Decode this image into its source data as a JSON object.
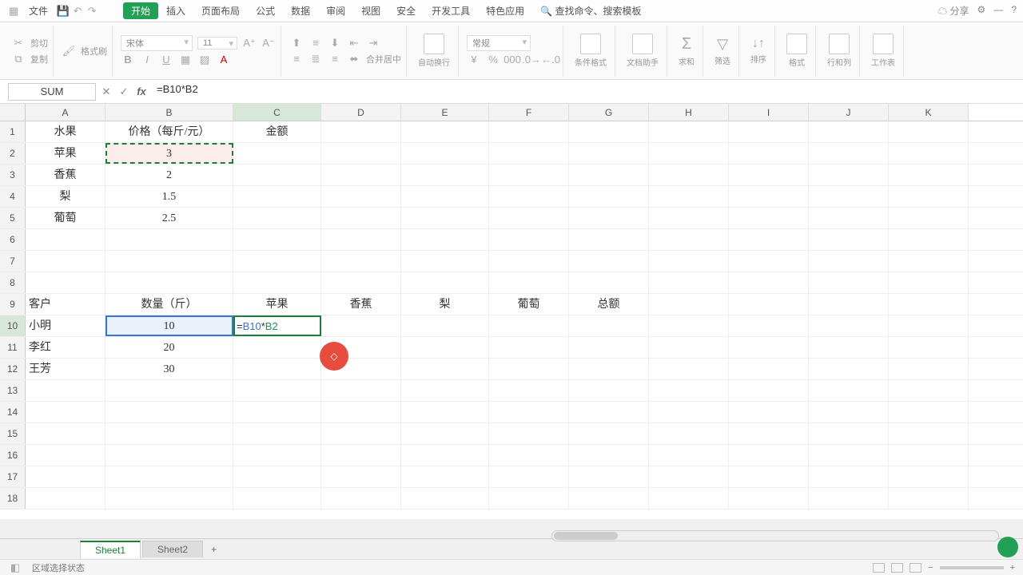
{
  "menu": {
    "file": "文件",
    "items": [
      "插入",
      "页面布局",
      "公式",
      "数据",
      "审阅",
      "视图",
      "安全",
      "开发工具",
      "特色应用"
    ],
    "start": "开始",
    "search": "查找命令、搜索模板",
    "share": "分享"
  },
  "ribbon": {
    "cut": "剪切",
    "copy": "复制",
    "paste": "格式刷",
    "font": "宋体",
    "size": "11",
    "numfmt": "常规",
    "wrap": "自动换行",
    "merge": "合并居中",
    "cond": "条件格式",
    "doc": "文档助手",
    "sum": "求和",
    "filter": "筛选",
    "sort": "排序",
    "fmt": "格式",
    "rowcol": "行和列",
    "ws": "工作表"
  },
  "fb": {
    "name": "SUM",
    "formula": "=B10*B2"
  },
  "cols": [
    "A",
    "B",
    "C",
    "D",
    "E",
    "F",
    "G",
    "H",
    "I",
    "J",
    "K"
  ],
  "widths": [
    100,
    160,
    110,
    100,
    110,
    100,
    100,
    100,
    100,
    100,
    100
  ],
  "data": {
    "r1": {
      "A": "水果",
      "B": "价格（每斤/元）",
      "C": "金额"
    },
    "r2": {
      "A": "苹果",
      "B": "3"
    },
    "r3": {
      "A": "香蕉",
      "B": "2"
    },
    "r4": {
      "A": "梨",
      "B": "1.5"
    },
    "r5": {
      "A": "葡萄",
      "B": "2.5"
    },
    "r9": {
      "A": "客户",
      "B": "数量（斤）",
      "C": "苹果",
      "D": "香蕉",
      "E": "梨",
      "F": "葡萄",
      "G": "总额"
    },
    "r10": {
      "A": "小明",
      "B": "10"
    },
    "r11": {
      "A": "李红",
      "B": "20"
    },
    "r12": {
      "A": "王芳",
      "B": "30"
    }
  },
  "edit": {
    "pre": "=",
    "ref1": "B10",
    "op": "*",
    "ref2": "B2"
  },
  "tabs": {
    "s1": "Sheet1",
    "s2": "Sheet2",
    "add": "+"
  },
  "status": {
    "mode": "区域选择状态"
  }
}
